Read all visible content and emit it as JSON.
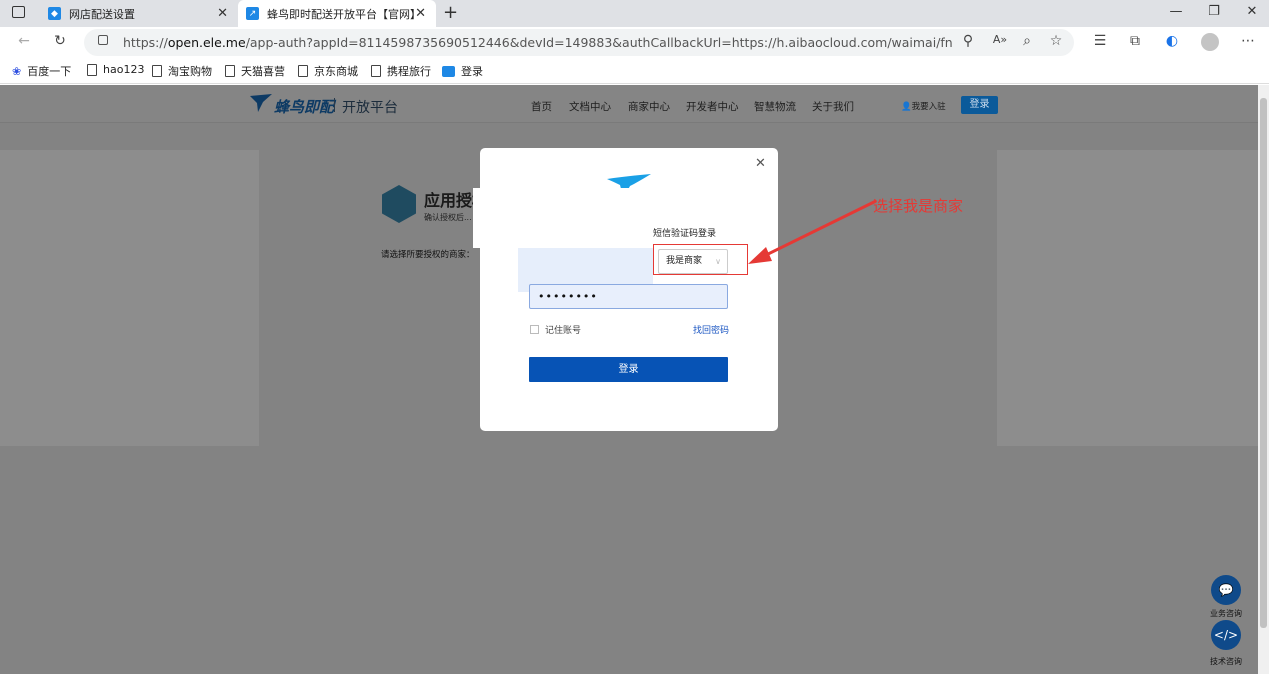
{
  "browser": {
    "tabs": [
      {
        "title": "网店配送设置"
      },
      {
        "title": "蜂鸟即时配送开放平台【官网】"
      }
    ],
    "new_tab": "+",
    "url_prefix": "https://",
    "url_domain": "open.ele.me",
    "url_rest": "/app-auth?appId=8114598735690512446&devId=149883&authCallbackUrl=https://h.aibaocloud.com/waimai/fnptCallback/authorizationCall...",
    "bookmarks": [
      "百度一下",
      "hao123",
      "淘宝购物",
      "天猫喜营",
      "京东商城",
      "携程旅行",
      "登录"
    ]
  },
  "site": {
    "logo": "蜂鸟即配",
    "logo_sub": "开放平台",
    "nav": [
      "首页",
      "文档中心",
      "商家中心",
      "开发者中心",
      "智慧物流",
      "关于我们"
    ],
    "join": "我要入驻",
    "login": "登录",
    "app_title": "应用授权",
    "app_sub": "确认授权后...",
    "select_label": "请选择所要授权的商家：",
    "float_buttons": [
      "业务咨询",
      "技术咨询"
    ]
  },
  "modal": {
    "sms_login": "短信验证码登录",
    "role": "我是商家",
    "password_mask": "••••••••",
    "remember": "记住账号",
    "find_password": "找回密码",
    "login_button": "登录"
  },
  "annotation": {
    "text": "选择我是商家",
    "color": "#e53935"
  }
}
